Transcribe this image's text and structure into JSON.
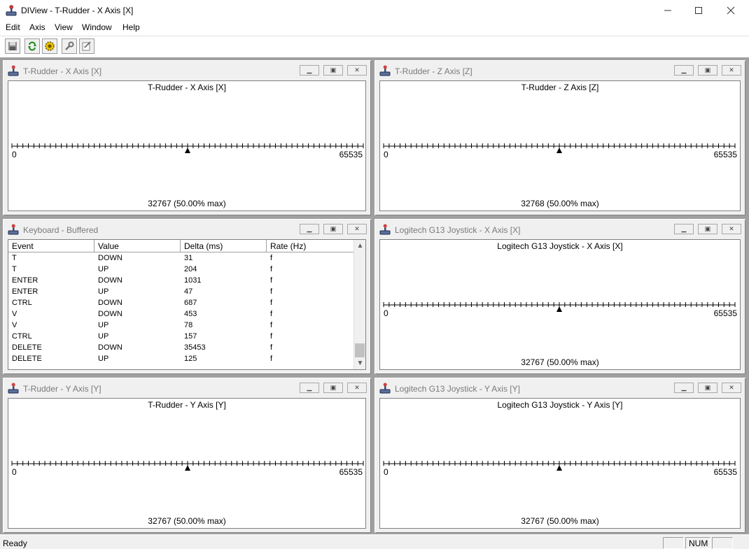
{
  "window": {
    "title": "DIView - T-Rudder - X Axis [X]"
  },
  "menu": [
    "Edit",
    "Axis",
    "View",
    "Window",
    "Help"
  ],
  "toolbar": [
    "save-icon",
    "refresh-icon",
    "settings-gear-icon",
    "properties-wrench-icon",
    "edit-properties-icon"
  ],
  "children": [
    {
      "caption": "T-Rudder - X Axis [X]",
      "axis_title": "T-Rudder - X Axis [X]",
      "min": "0",
      "max": "65535",
      "value_label": "32767 (50.00% max)",
      "value": 32767,
      "range_max": 65535
    },
    {
      "caption": "T-Rudder - Z Axis [Z]",
      "axis_title": "T-Rudder - Z Axis [Z]",
      "min": "0",
      "max": "65535",
      "value_label": "32768 (50.00% max)",
      "value": 32768,
      "range_max": 65535
    },
    {
      "caption": "Logitech G13 Joystick - X Axis [X]",
      "axis_title": "Logitech G13 Joystick - X Axis [X]",
      "min": "0",
      "max": "65535",
      "value_label": "32767 (50.00% max)",
      "value": 32767,
      "range_max": 65535
    },
    {
      "caption": "T-Rudder - Y Axis [Y]",
      "axis_title": "T-Rudder - Y Axis [Y]",
      "min": "0",
      "max": "65535",
      "value_label": "32767 (50.00% max)",
      "value": 32767,
      "range_max": 65535
    },
    {
      "caption": "Logitech G13 Joystick - Y Axis [Y]",
      "axis_title": "Logitech G13 Joystick - Y Axis [Y]",
      "min": "0",
      "max": "65535",
      "value_label": "32767 (50.00% max)",
      "value": 32767,
      "range_max": 65535
    }
  ],
  "keyboard": {
    "caption": "Keyboard - Buffered",
    "columns": [
      "Event",
      "Value",
      "Delta (ms)",
      "Rate (Hz)"
    ],
    "rows": [
      [
        "T",
        "DOWN",
        "31",
        "f"
      ],
      [
        "T",
        "UP",
        "204",
        "f"
      ],
      [
        "ENTER",
        "DOWN",
        "1031",
        "f"
      ],
      [
        "ENTER",
        "UP",
        "47",
        "f"
      ],
      [
        "CTRL",
        "DOWN",
        "687",
        "f"
      ],
      [
        "V",
        "DOWN",
        "453",
        "f"
      ],
      [
        "V",
        "UP",
        "78",
        "f"
      ],
      [
        "CTRL",
        "UP",
        "157",
        "f"
      ],
      [
        "DELETE",
        "DOWN",
        "35453",
        "f"
      ],
      [
        "DELETE",
        "UP",
        "125",
        "f"
      ]
    ]
  },
  "status": {
    "text": "Ready",
    "num": "NUM"
  }
}
